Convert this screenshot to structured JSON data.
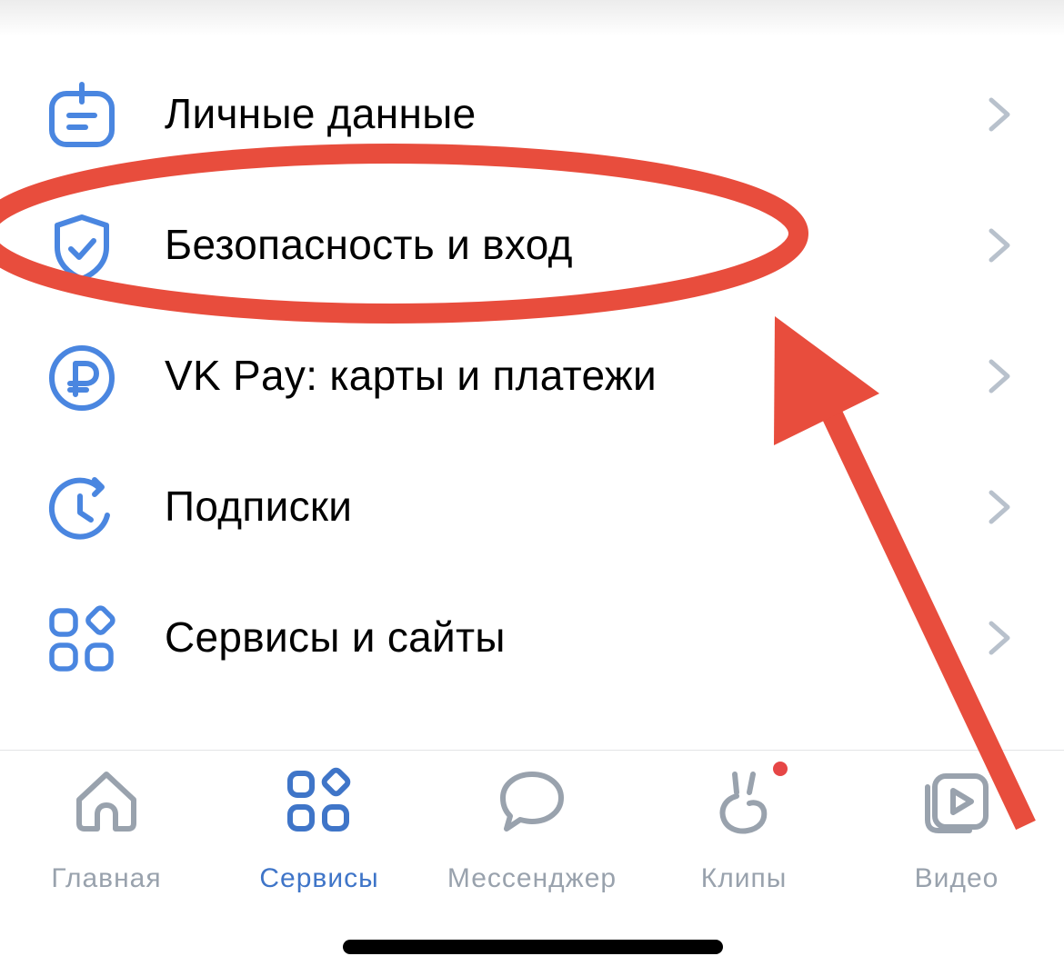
{
  "menu": {
    "items": [
      {
        "label": "Личные данные",
        "icon": "personal-data-icon"
      },
      {
        "label": "Безопасность и вход",
        "icon": "shield-check-icon"
      },
      {
        "label": "VK Pay: карты и платежи",
        "icon": "ruble-icon"
      },
      {
        "label": "Подписки",
        "icon": "clock-refresh-icon"
      },
      {
        "label": "Сервисы и сайты",
        "icon": "services-grid-icon"
      }
    ]
  },
  "tabbar": {
    "tabs": [
      {
        "label": "Главная",
        "icon": "home-icon",
        "active": false
      },
      {
        "label": "Сервисы",
        "icon": "services-grid-icon",
        "active": true
      },
      {
        "label": "Мессенджер",
        "icon": "chat-bubble-icon",
        "active": false
      },
      {
        "label": "Клипы",
        "icon": "clips-icon",
        "active": false,
        "notification": true
      },
      {
        "label": "Видео",
        "icon": "video-icon",
        "active": false
      }
    ]
  },
  "annotation": {
    "highlighted_item": "Безопасность и вход",
    "color": "#e84d3d"
  },
  "colors": {
    "accent_blue": "#3f75c8",
    "icon_blue": "#4a86e0",
    "inactive_gray": "#99a2ad",
    "chevron_gray": "#b8c1cc",
    "badge_red": "#e64646"
  }
}
